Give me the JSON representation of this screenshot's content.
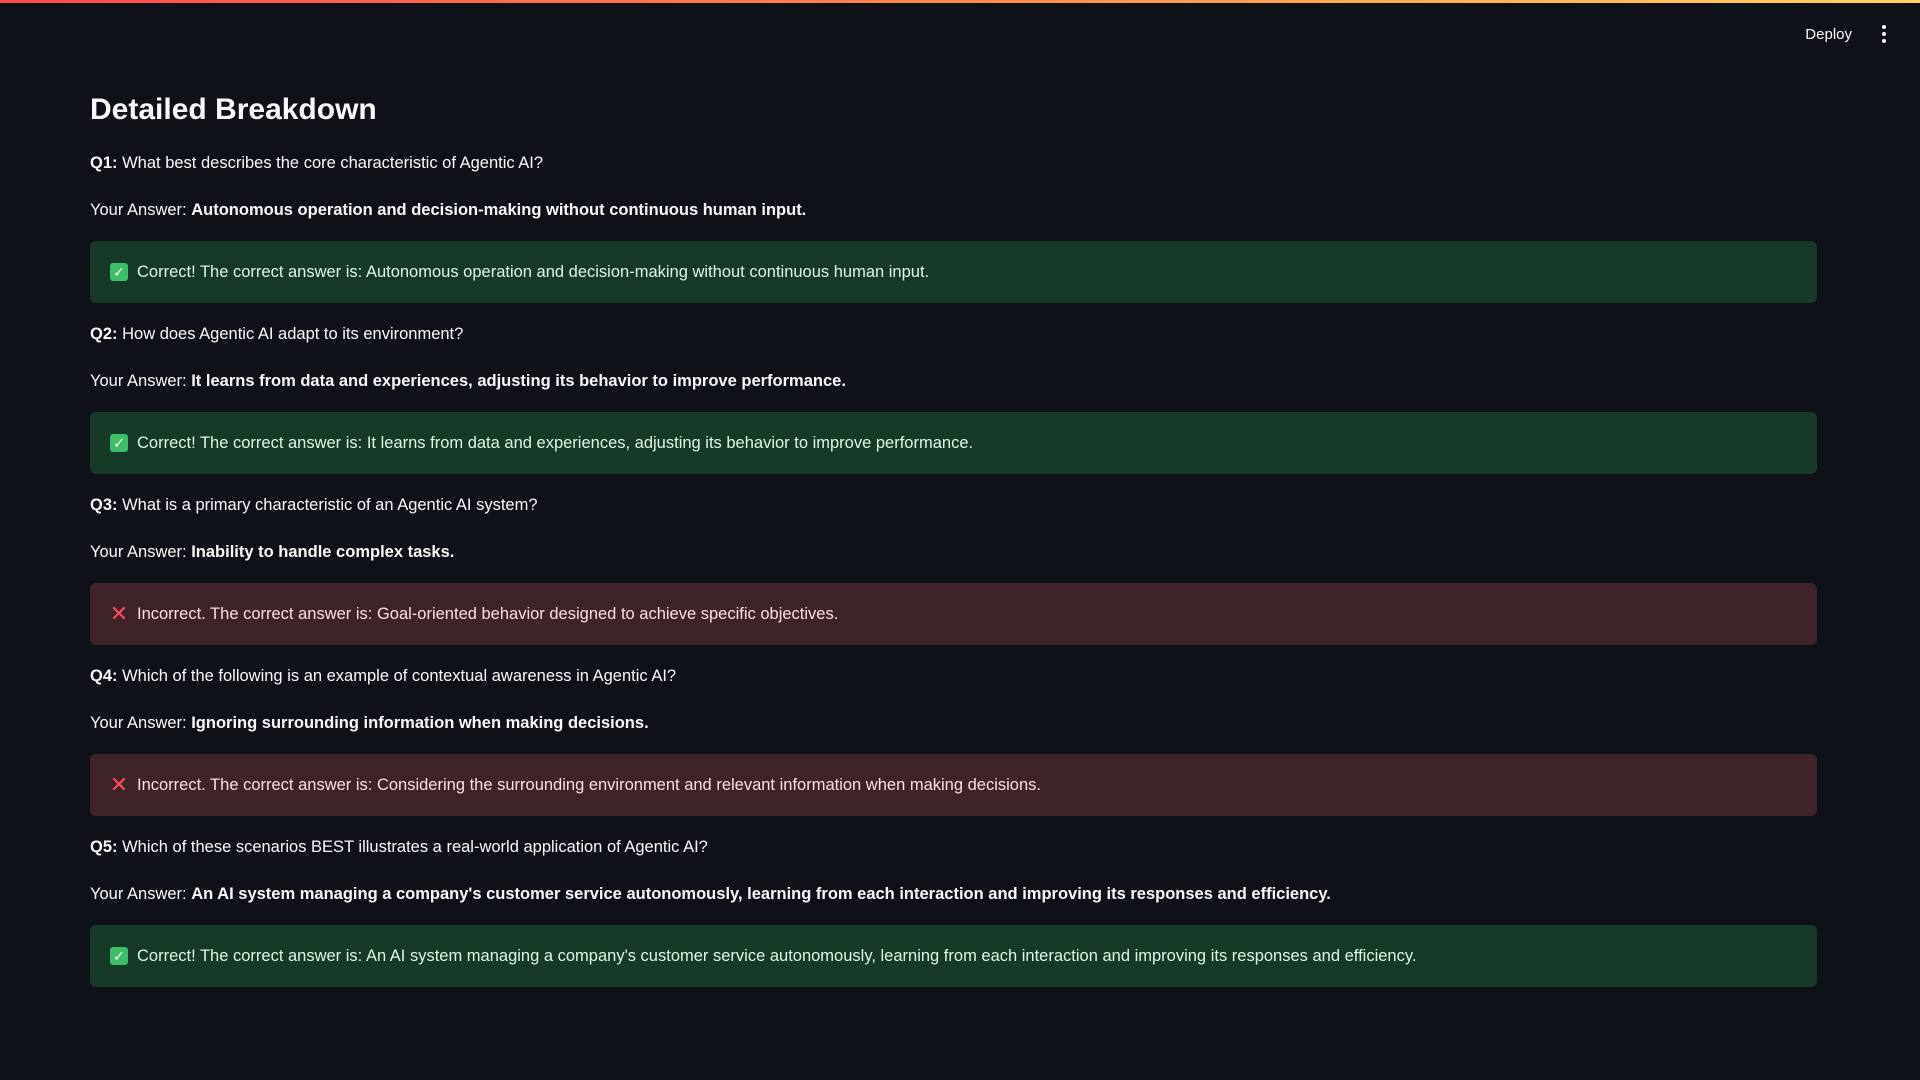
{
  "header": {
    "deploy_label": "Deploy",
    "menu_icon": "kebab-menu-icon"
  },
  "main": {
    "title": "Detailed Breakdown",
    "answer_prefix": "Your Answer:",
    "questions": [
      {
        "label": "Q1:",
        "text": "What best describes the core characteristic of Agentic AI?",
        "your_answer": "Autonomous operation and decision-making without continuous human input.",
        "status": "correct",
        "icon": "check-icon",
        "feedback": "Correct! The correct answer is: Autonomous operation and decision-making without continuous human input."
      },
      {
        "label": "Q2:",
        "text": "How does Agentic AI adapt to its environment?",
        "your_answer": "It learns from data and experiences, adjusting its behavior to improve performance.",
        "status": "correct",
        "icon": "check-icon",
        "feedback": "Correct! The correct answer is: It learns from data and experiences, adjusting its behavior to improve performance."
      },
      {
        "label": "Q3:",
        "text": "What is a primary characteristic of an Agentic AI system?",
        "your_answer": "Inability to handle complex tasks.",
        "status": "incorrect",
        "icon": "cross-icon",
        "feedback": "Incorrect. The correct answer is: Goal-oriented behavior designed to achieve specific objectives."
      },
      {
        "label": "Q4:",
        "text": "Which of the following is an example of contextual awareness in Agentic AI?",
        "your_answer": "Ignoring surrounding information when making decisions.",
        "status": "incorrect",
        "icon": "cross-icon",
        "feedback": "Incorrect. The correct answer is: Considering the surrounding environment and relevant information when making decisions."
      },
      {
        "label": "Q5:",
        "text": "Which of these scenarios BEST illustrates a real-world application of Agentic AI?",
        "your_answer": "An AI system managing a company's customer service autonomously, learning from each interaction and improving its responses and efficiency.",
        "status": "correct",
        "icon": "check-icon",
        "feedback": "Correct! The correct answer is: An AI system managing a company's customer service autonomously, learning from each interaction and improving its responses and efficiency."
      }
    ]
  },
  "colors": {
    "background": "#0e1117",
    "correct_bg": "#173928",
    "incorrect_bg": "#3e2428",
    "check_green": "#3dbf6a",
    "cross_red": "#ff4b5c"
  }
}
